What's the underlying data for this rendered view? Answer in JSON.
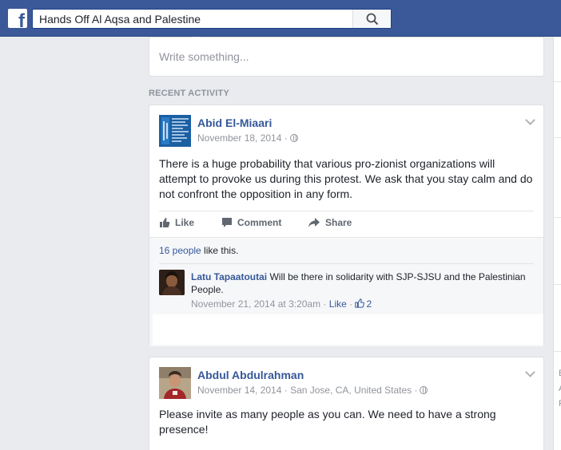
{
  "header": {
    "search_value": "Hands Off Al Aqsa and Palestine"
  },
  "composer": {
    "placeholder": "Write something..."
  },
  "section": {
    "title": "RECENT ACTIVITY"
  },
  "posts": [
    {
      "author": "Abid El-Miaari",
      "date": "November 18, 2014 ·",
      "text": "There is a huge probability that various pro-zionist organizations will attempt to provoke us during this protest. We ask that you stay calm and do not confront the opposition in any form.",
      "actions": {
        "like": "Like",
        "comment": "Comment",
        "share": "Share"
      },
      "likes_count": "16 people",
      "likes_suffix": " like this.",
      "comment": {
        "author": "Latu Tapaatoutai",
        "text": " Will be there in solidarity with SJP-SJSU and the Palestinian People.",
        "time": "November 21, 2014 at 3:20am · ",
        "like": "Like",
        "dot": " · ",
        "like_count": "2"
      }
    },
    {
      "author": "Abdul Abdulrahman",
      "date": "November 14, 2014 · San Jose, CA, United States ·",
      "text": "Please invite as many people as you can. We need to have a strong presence!"
    }
  ],
  "right_column": {
    "letters": [
      "E",
      "A",
      "F"
    ]
  },
  "colors": {
    "brand": "#3b5998",
    "link": "#365899",
    "muted": "#90949c",
    "background": "#e9ebee"
  },
  "icons": [
    "facebook-logo-icon",
    "search-icon",
    "globe-icon",
    "chevron-down-icon",
    "like-icon",
    "comment-icon",
    "share-icon",
    "thumbs-up-icon"
  ]
}
